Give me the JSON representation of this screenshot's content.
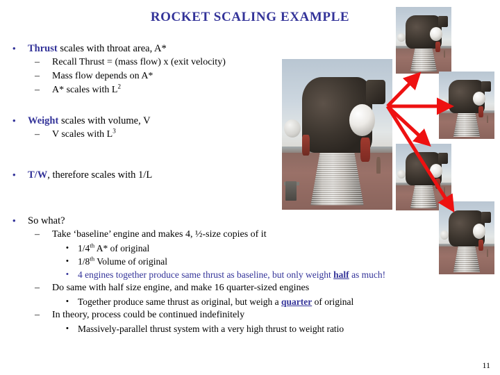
{
  "slide": {
    "title": "ROCKET SCALING EXAMPLE",
    "page_number": "11",
    "accent_color": "#333399",
    "arrow_color": "#ee1111",
    "text_color": "#000000"
  },
  "content": {
    "b1": {
      "lead": "Thrust",
      "rest": " scales with throat area, A*",
      "sub": [
        "Recall Thrust = (mass flow) x (exit velocity)",
        "Mass flow depends on A*"
      ],
      "sub_sup_pre": "A* scales with L",
      "sub_sup": "2"
    },
    "b2": {
      "lead": "Weight",
      "rest": " scales with volume, V",
      "sub_sup_pre": "V scales with L",
      "sub_sup": "3"
    },
    "b3": {
      "lead": "T/W",
      "rest": ", therefore scales with 1/L"
    },
    "b4": {
      "lead": "So what?",
      "sub1": "Take ‘baseline’ engine and makes 4, ½-size copies of it",
      "sub1_items": [
        {
          "pre": "1/4",
          "sup": "th",
          "post": " A* of original"
        },
        {
          "pre": "1/8",
          "sup": "th",
          "post": " Volume of original"
        }
      ],
      "highlight_line": {
        "pre": "4 engines together produce same thrust as baseline, but only weight ",
        "emph": "half",
        "post": " as much!"
      },
      "sub2": "Do same with half size engine, and make 16 quarter-sized engines",
      "sub2_item": {
        "pre": "Together produce same thrust as original, but weigh a ",
        "emph": "quarter",
        "post": " of original"
      },
      "sub3": "In theory, process could be continued indefinitely",
      "sub3_item": "Massively-parallel thrust system with a very high thrust to weight ratio"
    }
  },
  "figure": {
    "baseline_label": "rocket-engine-baseline-photo",
    "copies_label": "rocket-engine-half-size-copy",
    "copy_count": 4,
    "bullets": {
      "dot": "•",
      "dash": "–"
    }
  }
}
